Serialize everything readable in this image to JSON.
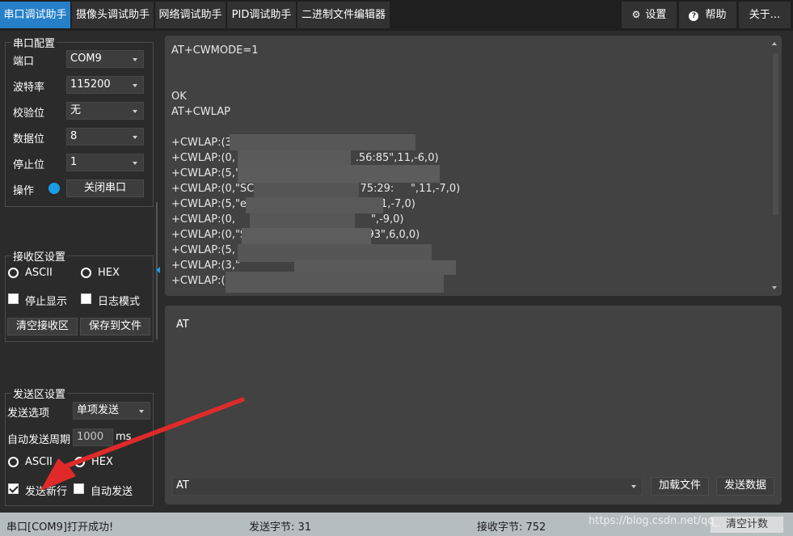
{
  "tabs": [
    {
      "label": "串口调试助手",
      "active": true
    },
    {
      "label": "摄像头调试助手",
      "active": false
    },
    {
      "label": "网络调试助手",
      "active": false
    },
    {
      "label": "PID调试助手",
      "active": false
    },
    {
      "label": "二进制文件编辑器",
      "active": false
    }
  ],
  "top_buttons": {
    "settings": "设置",
    "help": "帮助",
    "about": "关于..."
  },
  "serial_config": {
    "title": "串口配置",
    "port_label": "端口",
    "port_value": "COM9",
    "baud_label": "波特率",
    "baud_value": "115200",
    "parity_label": "校验位",
    "parity_value": "无",
    "databits_label": "数据位",
    "databits_value": "8",
    "stopbits_label": "停止位",
    "stopbits_value": "1",
    "op_label": "操作",
    "close_port_button": "关闭串口"
  },
  "recv_settings": {
    "title": "接收区设置",
    "ascii_label": "ASCII",
    "hex_label": "HEX",
    "stop_display_label": "停止显示",
    "log_mode_label": "日志模式",
    "clear_recv_button": "清空接收区",
    "save_file_button": "保存到文件"
  },
  "send_settings": {
    "title": "发送区设置",
    "send_option_label": "发送选项",
    "send_option_value": "单项发送",
    "auto_period_label": "自动发送周期",
    "auto_period_value": "1000",
    "auto_period_unit": "ms",
    "ascii_label": "ASCII",
    "hex_label": "HEX",
    "send_newline_label": "发送新行",
    "auto_send_label": "自动发送"
  },
  "receive_lines": [
    "AT+CWMODE=1",
    "",
    "",
    "OK",
    "AT+CWLAP",
    "",
    "+CWLAP:(3                                             ,6,0)",
    "+CWLAP:(0,                                    .56:85\",11,-6,0)",
    "+CWLAP:(5,\"e",
    "+CWLAP:(0,\"SC      \"          \"3c:6     :75:29:     \",11,-7,0)",
    "+CWLAP:(5,\"ec                                  \",11,-7,0)",
    "+CWLAP:(0,                 ua.09.0c          \",-9,0)",
    "+CWLAP:(0,\"S                              5:3:93\",6,0,0)",
    "+CWLAP:(5,                                              0)",
    "+CWLAP:(3,\"",
    "+CWLAP:("
  ],
  "send_area_text": "AT",
  "send_input_value": "AT",
  "load_file_button": "加载文件",
  "send_data_button": "发送数据",
  "status": {
    "message": "串口[COM9]打开成功!",
    "sent_bytes": "发送字节: 31",
    "recv_bytes": "接收字节: 752",
    "clear_count_button": "清空计数"
  },
  "watermark": "https://blog.csdn.net/qq_",
  "colors": {
    "accent": "#2680c9",
    "led": "#1c9ce6",
    "arrow": "#e02a2a"
  }
}
